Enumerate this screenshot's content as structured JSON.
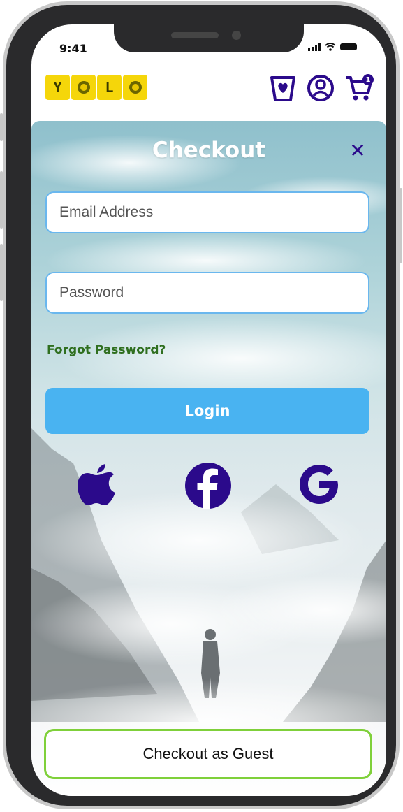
{
  "status_bar": {
    "time": "9:41"
  },
  "brand": {
    "letters": [
      "Y",
      "",
      "L",
      ""
    ],
    "tile_color": "#f5d60a"
  },
  "header": {
    "cart_count": "1",
    "icons": [
      "wishlist-bag-icon",
      "account-icon",
      "cart-icon"
    ],
    "accent": "#2b0a8b"
  },
  "checkout": {
    "title": "Checkout",
    "close_symbol": "✕",
    "email_placeholder": "Email Address",
    "password_placeholder": "Password",
    "forgot_label": "Forgot Password?",
    "login_label": "Login",
    "social": [
      "apple-icon",
      "facebook-icon",
      "google-icon"
    ],
    "guest_label": "Checkout as Guest"
  },
  "colors": {
    "login_button": "#49b3f1",
    "field_border": "#6ab7ee",
    "guest_border": "#7fd03a",
    "forgot_text": "#2f6f1f"
  }
}
